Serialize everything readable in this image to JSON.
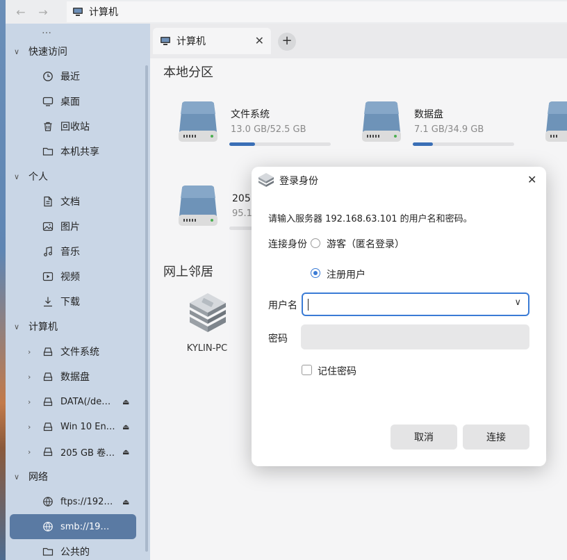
{
  "titlebar": {
    "title": "计算机"
  },
  "sidebar": {
    "items": [
      {
        "label": "快速访问",
        "icon": "chevron-down-icon",
        "level": 0
      },
      {
        "label": "最近",
        "icon": "clock-icon",
        "level": 1
      },
      {
        "label": "桌面",
        "icon": "desktop-icon",
        "level": 1
      },
      {
        "label": "回收站",
        "icon": "trash-icon",
        "level": 1
      },
      {
        "label": "本机共享",
        "icon": "folder-icon",
        "level": 1
      },
      {
        "label": "个人",
        "icon": "chevron-down-icon",
        "level": 0
      },
      {
        "label": "文档",
        "icon": "document-icon",
        "level": 1
      },
      {
        "label": "图片",
        "icon": "image-icon",
        "level": 1
      },
      {
        "label": "音乐",
        "icon": "music-icon",
        "level": 1
      },
      {
        "label": "视频",
        "icon": "video-icon",
        "level": 1
      },
      {
        "label": "下载",
        "icon": "download-icon",
        "level": 1
      },
      {
        "label": "计算机",
        "icon": "chevron-down-icon",
        "level": 0
      },
      {
        "label": "文件系统",
        "icon": "drive-icon",
        "level": 1
      },
      {
        "label": "数据盘",
        "icon": "drive-icon",
        "level": 1
      },
      {
        "label": "DATA(/de…",
        "icon": "drive-icon",
        "level": 1
      },
      {
        "label": "Win 10 En…",
        "icon": "drive-icon",
        "level": 1
      },
      {
        "label": "205 GB 卷…",
        "icon": "drive-icon",
        "level": 1
      },
      {
        "label": "网络",
        "icon": "chevron-down-icon",
        "level": 0
      },
      {
        "label": "ftps://192…",
        "icon": "network-icon",
        "level": 1
      },
      {
        "label": "smb://19…",
        "icon": "network-icon",
        "level": 1
      },
      {
        "label": "公共的",
        "icon": "folder-icon",
        "level": 1
      }
    ]
  },
  "tabs": [
    {
      "label": "计算机"
    }
  ],
  "content": {
    "local_title": "本地分区",
    "network_title": "网上邻居",
    "drives": [
      {
        "name": "文件系统",
        "size": "13.0 GB/52.5 GB",
        "usage": 0.25
      },
      {
        "name": "数据盘",
        "size": "7.1 GB/34.9 GB",
        "usage": 0.2
      },
      {
        "name": "205 GB 卷",
        "size": "95.1 M",
        "usage": 0.0
      }
    ],
    "network_pc": "KYLIN-PC"
  },
  "dialog": {
    "title": "登录身份",
    "prompt": "请输入服务器 192.168.63.101 的用户名和密码。",
    "connect_as_label": "连接身份",
    "option_guest": "游客（匿名登录）",
    "option_registered": "注册用户",
    "selected_option": "注册用户",
    "username_label": "用户名",
    "username_value": "",
    "password_label": "密码",
    "remember_label": "记住密码",
    "remember_checked": false,
    "cancel_label": "取消",
    "connect_label": "连接"
  },
  "colors": {
    "accent": "#3a7bd5",
    "sidebar_active": "#5a7aa3",
    "sidebar_bg": "#c9d6e6"
  }
}
